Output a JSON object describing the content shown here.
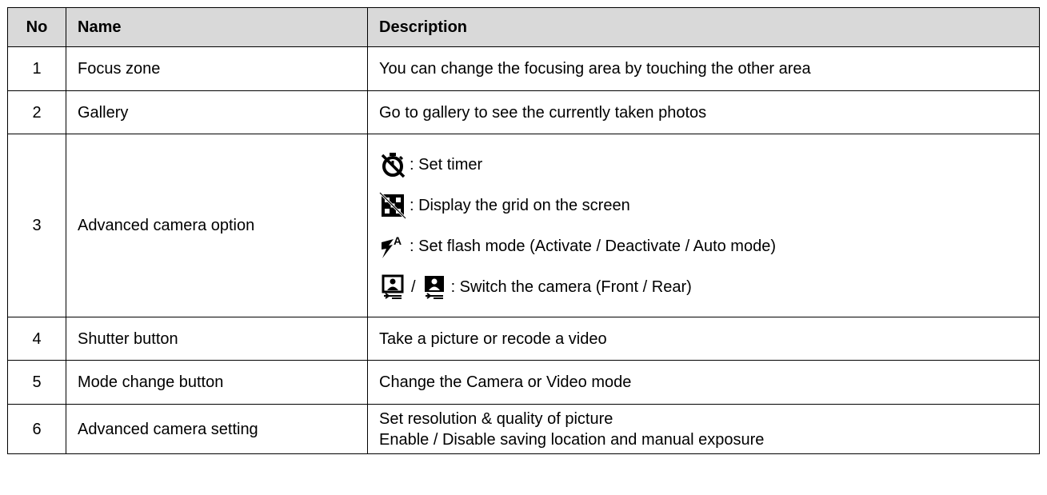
{
  "table": {
    "headers": {
      "no": "No",
      "name": "Name",
      "description": "Description"
    },
    "rows": [
      {
        "no": "1",
        "name": "Focus zone",
        "description": "You can change the focusing area by touching the other area"
      },
      {
        "no": "2",
        "name": "Gallery",
        "description": "Go to gallery to see the currently taken photos"
      },
      {
        "no": "3",
        "name": "Advanced camera option",
        "options": [
          {
            "icon": "timer-off-icon",
            "text": ": Set timer"
          },
          {
            "icon": "grid-off-icon",
            "text": ": Display the grid on the screen"
          },
          {
            "icon": "flash-auto-icon",
            "text": ": Set flash mode (Activate / Deactivate / Auto mode)"
          },
          {
            "icon": "camera-front-icon",
            "separator": "/",
            "icon2": "camera-rear-icon",
            "text": ": Switch the camera (Front / Rear)"
          }
        ]
      },
      {
        "no": "4",
        "name": "Shutter button",
        "description": "Take a picture or recode a video"
      },
      {
        "no": "5",
        "name": "Mode change button",
        "description": "Change the Camera or Video mode"
      },
      {
        "no": "6",
        "name": "Advanced camera setting",
        "description_lines": [
          "Set resolution & quality of picture",
          "Enable / Disable saving location and manual exposure"
        ]
      }
    ]
  }
}
